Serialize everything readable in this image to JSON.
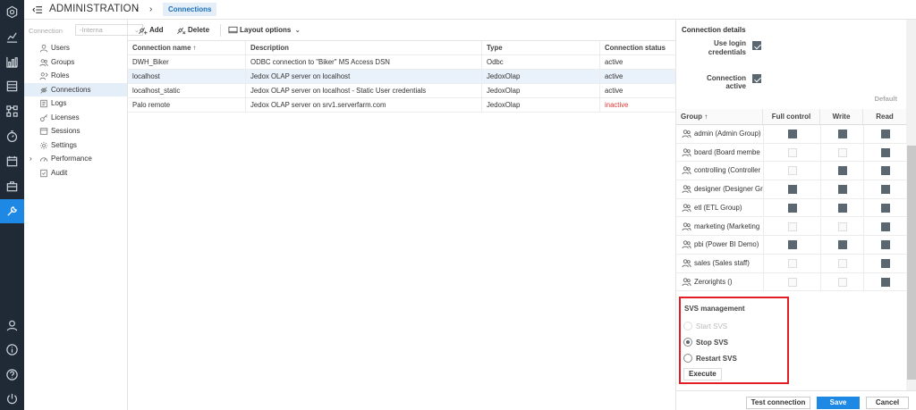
{
  "header": {
    "title": "ADMINISTRATION",
    "breadcrumb": "Connections"
  },
  "tree": {
    "connection_label": "Connection",
    "connection_value": "-Interna",
    "items": [
      {
        "label": "Users",
        "icon": "user-icon"
      },
      {
        "label": "Groups",
        "icon": "group-icon"
      },
      {
        "label": "Roles",
        "icon": "roles-icon"
      },
      {
        "label": "Connections",
        "icon": "connections-icon",
        "selected": true
      },
      {
        "label": "Logs",
        "icon": "logs-icon"
      },
      {
        "label": "Licenses",
        "icon": "key-icon"
      },
      {
        "label": "Sessions",
        "icon": "sessions-icon"
      },
      {
        "label": "Settings",
        "icon": "gear-icon"
      },
      {
        "label": "Performance",
        "icon": "gauge-icon",
        "expandable": true
      },
      {
        "label": "Audit",
        "icon": "audit-icon"
      }
    ]
  },
  "toolbar": {
    "add_label": "Add",
    "delete_label": "Delete",
    "layout_label": "Layout options"
  },
  "grid": {
    "columns": [
      "Connection name",
      "Description",
      "Type",
      "Connection status"
    ],
    "rows": [
      {
        "name": "DWH_Biker",
        "description": "ODBC connection to \"Biker\" MS Access DSN",
        "type": "Odbc",
        "status": "active"
      },
      {
        "name": "localhost",
        "description": "Jedox OLAP server on localhost",
        "type": "JedoxOlap",
        "status": "active",
        "selected": true
      },
      {
        "name": "localhost_static",
        "description": "Jedox OLAP server on localhost - Static User credentials",
        "type": "JedoxOlap",
        "status": "active"
      },
      {
        "name": "Palo remote",
        "description": "Jedox OLAP server on srv1.serverfarm.com",
        "type": "JedoxOlap",
        "status": "inactive"
      }
    ]
  },
  "details": {
    "title": "Connection details",
    "use_login_label": "Use login credentials",
    "connection_active_label": "Connection active",
    "default_label": "Default",
    "perm_columns": [
      "Group",
      "Full control",
      "Write",
      "Read"
    ],
    "groups": [
      {
        "name": "admin (Admin Group)",
        "full": "checked",
        "write": "checked",
        "read": "checked"
      },
      {
        "name": "board (Board membe",
        "full": "disabled",
        "write": "disabled",
        "read": "checked"
      },
      {
        "name": "controlling (Controller",
        "full": "disabled",
        "write": "checked",
        "read": "checked"
      },
      {
        "name": "designer (Designer Gr",
        "full": "checked",
        "write": "checked",
        "read": "checked"
      },
      {
        "name": "etl (ETL Group)",
        "full": "checked",
        "write": "checked",
        "read": "checked"
      },
      {
        "name": "marketing (Marketing",
        "full": "disabled",
        "write": "disabled",
        "read": "checked"
      },
      {
        "name": "pbi (Power BI Demo)",
        "full": "checked",
        "write": "checked",
        "read": "checked"
      },
      {
        "name": "sales (Sales staff)",
        "full": "disabled",
        "write": "disabled",
        "read": "checked"
      },
      {
        "name": "Zerorights ()",
        "full": "disabled",
        "write": "disabled",
        "read": "checked"
      }
    ],
    "svs": {
      "title": "SVS management",
      "start_label": "Start SVS",
      "stop_label": "Stop SVS",
      "restart_label": "Restart SVS",
      "execute_label": "Execute"
    }
  },
  "footer": {
    "test_label": "Test connection",
    "save_label": "Save",
    "cancel_label": "Cancel"
  },
  "colors": {
    "accent": "#1e88e5",
    "rail": "#1f2a36",
    "highlight_box": "#e01f26",
    "inactive": "#e53935"
  }
}
